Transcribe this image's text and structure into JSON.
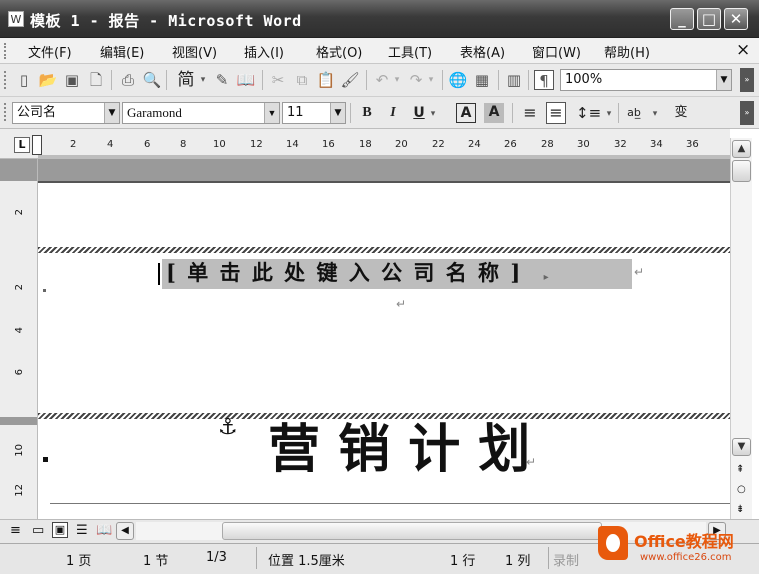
{
  "window": {
    "title": "模板 1 - 报告 - Microsoft Word",
    "controls": {
      "minimize": "_",
      "maximize": "□",
      "close": "✕"
    }
  },
  "menubar": {
    "items": [
      "文件(F)",
      "编辑(E)",
      "视图(V)",
      "插入(I)",
      "格式(O)",
      "工具(T)",
      "表格(A)",
      "窗口(W)",
      "帮助(H)"
    ],
    "close_doc": "×"
  },
  "standard_toolbar": {
    "simplified_label": "简",
    "zoom": "100%"
  },
  "formatting_toolbar": {
    "style": "公司名",
    "font": "Garamond",
    "size": "11",
    "bold": "B",
    "italic": "I",
    "underline": "U",
    "char_border": "A",
    "char_shading": "A"
  },
  "ruler": {
    "tab_marker": "L",
    "h_numbers": [
      "2",
      "4",
      "6",
      "8",
      "10",
      "12",
      "14",
      "16",
      "18",
      "20",
      "22",
      "24",
      "26",
      "28",
      "30",
      "32",
      "34",
      "36"
    ],
    "v_numbers": [
      "2",
      "2",
      "4",
      "6",
      "10",
      "12"
    ]
  },
  "document": {
    "company_placeholder": "[ 单 击 此 处 键 入 公 司 名 称 ]",
    "paragraph_mark": "↵",
    "title": "营 销 计 划"
  },
  "status": {
    "page": "1 页",
    "section": "1 节",
    "page_of": "1/3",
    "position": "位置 1.5厘米",
    "line": "1 行",
    "column": "1 列",
    "record": "录制"
  },
  "watermark": {
    "brand": "Office教程网",
    "url": "www.office26.com"
  },
  "colors": {
    "titlebar": "#3a3a3a",
    "watermark_orange": "#e8590c",
    "selection_gray": "#bdbdbd"
  }
}
